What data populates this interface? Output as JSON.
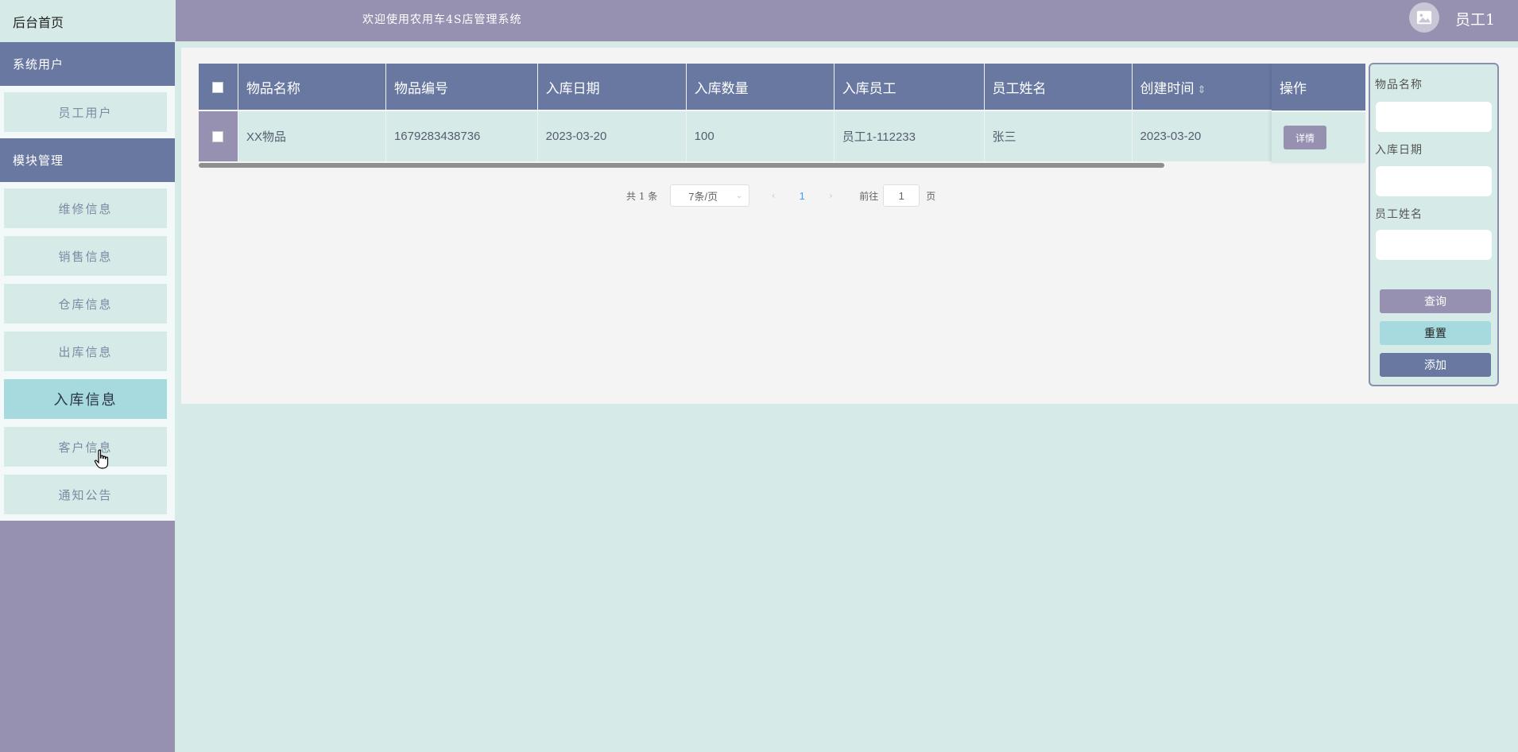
{
  "sidebar": {
    "home": "后台首页",
    "groups": [
      {
        "title": "系统用户",
        "items": [
          {
            "label": "员工用户"
          }
        ]
      },
      {
        "title": "模块管理",
        "items": [
          {
            "label": "维修信息"
          },
          {
            "label": "销售信息"
          },
          {
            "label": "仓库信息"
          },
          {
            "label": "出库信息"
          },
          {
            "label": "入库信息",
            "active": true
          },
          {
            "label": "客户信息"
          },
          {
            "label": "通知公告"
          }
        ]
      }
    ]
  },
  "header": {
    "title": "欢迎使用农用车4S店管理系统",
    "username": "员工1",
    "avatar_icon": "image-icon"
  },
  "table": {
    "columns": [
      "物品名称",
      "物品编号",
      "入库日期",
      "入库数量",
      "入库员工",
      "员工姓名",
      "创建时间",
      "操作"
    ],
    "rows": [
      {
        "cells": [
          "XX物品",
          "1679283438736",
          "2023-03-20",
          "100",
          "员工1-112233",
          "张三",
          "2023-03-20"
        ],
        "action": "详情"
      }
    ]
  },
  "pagination": {
    "total": "共 1 条",
    "page_size": "7条/页",
    "current_page": "1",
    "goto_label": "前往",
    "goto_value": "1",
    "goto_unit": "页"
  },
  "search": {
    "fields": [
      {
        "label": "物品名称",
        "value": ""
      },
      {
        "label": "入库日期",
        "value": ""
      },
      {
        "label": "员工姓名",
        "value": ""
      }
    ],
    "query_label": "查询",
    "reset_label": "重置",
    "add_label": "添加"
  },
  "colors": {
    "primary": "#6878a0",
    "lavender": "#9691b0",
    "mint": "#d6eae8",
    "active": "#a6dade"
  }
}
